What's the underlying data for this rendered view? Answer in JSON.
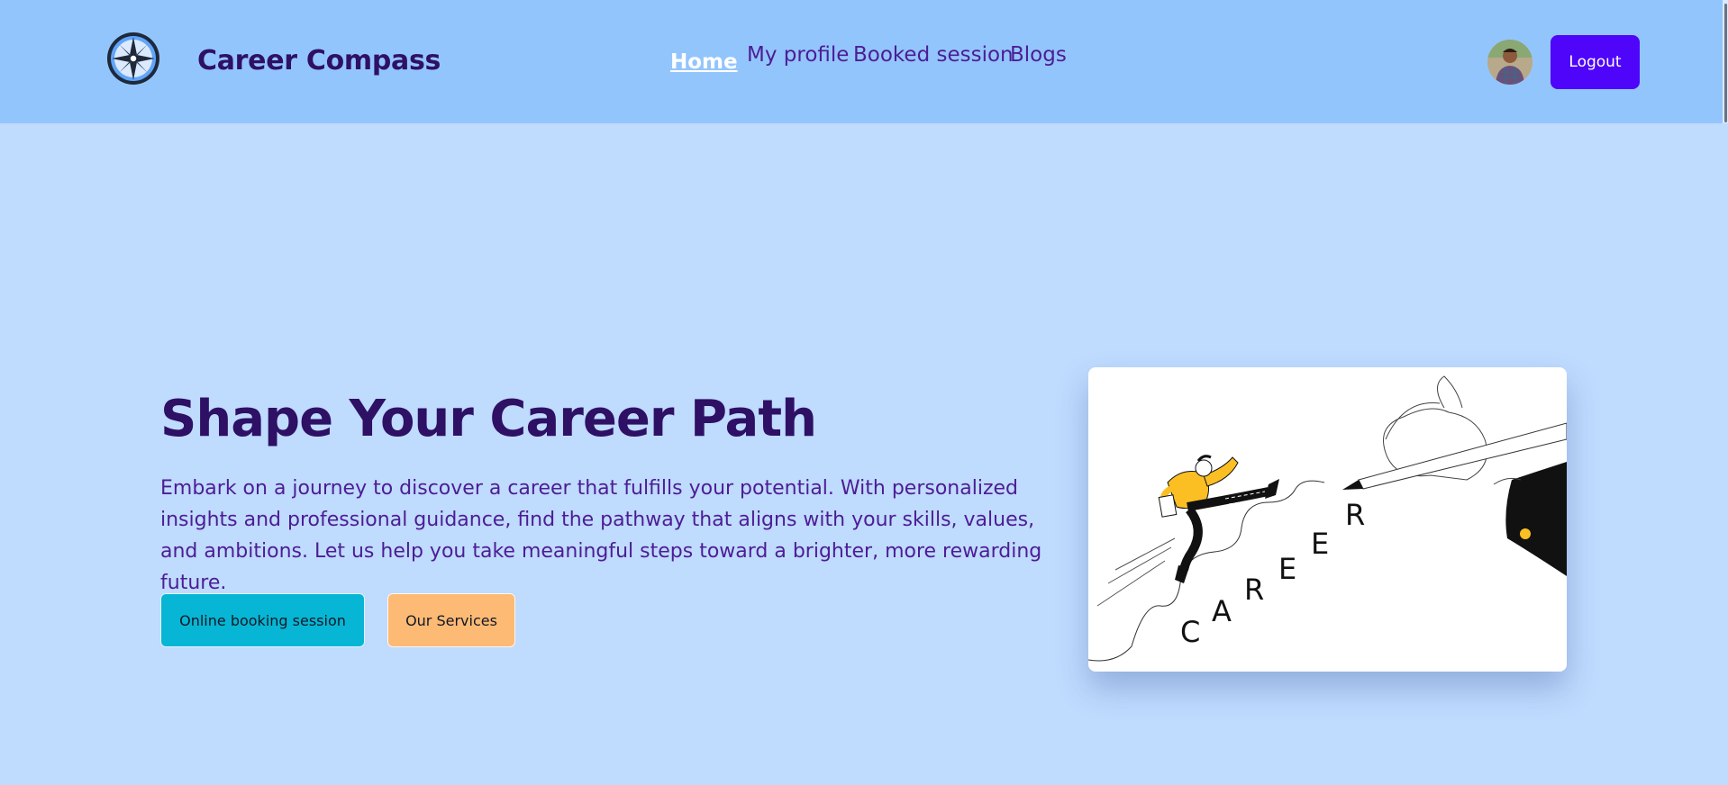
{
  "header": {
    "brand": "Career Compass",
    "nav": [
      {
        "label": "Home",
        "active": true
      },
      {
        "label": "My profile",
        "active": false
      },
      {
        "label": "Booked session",
        "active": false
      },
      {
        "label": "Blogs",
        "active": false
      }
    ],
    "logout_label": "Logout",
    "logo_icon": "compass-icon",
    "avatar_icon": "user-avatar"
  },
  "hero": {
    "title": "Shape Your Career Path",
    "description": "Embark on a journey to discover a career that fulfills your potential. With personalized insights and professional guidance, find the pathway that aligns with your skills, values, and ambitions. Let us help you take meaningful steps toward a brighter, more rewarding future.",
    "primary_button": "Online booking session",
    "secondary_button": "Our Services",
    "illustration": {
      "letters": [
        "C",
        "A",
        "R",
        "E",
        "E",
        "R"
      ]
    }
  },
  "colors": {
    "header_bg": "#93c5fd",
    "page_bg": "#bfdbfe",
    "brand_text": "#2e1065",
    "nav_text": "#4c1d95",
    "logout_bg": "#4f05fa",
    "primary_button_bg": "#06b6d4",
    "secondary_button_bg": "#fdba74"
  }
}
